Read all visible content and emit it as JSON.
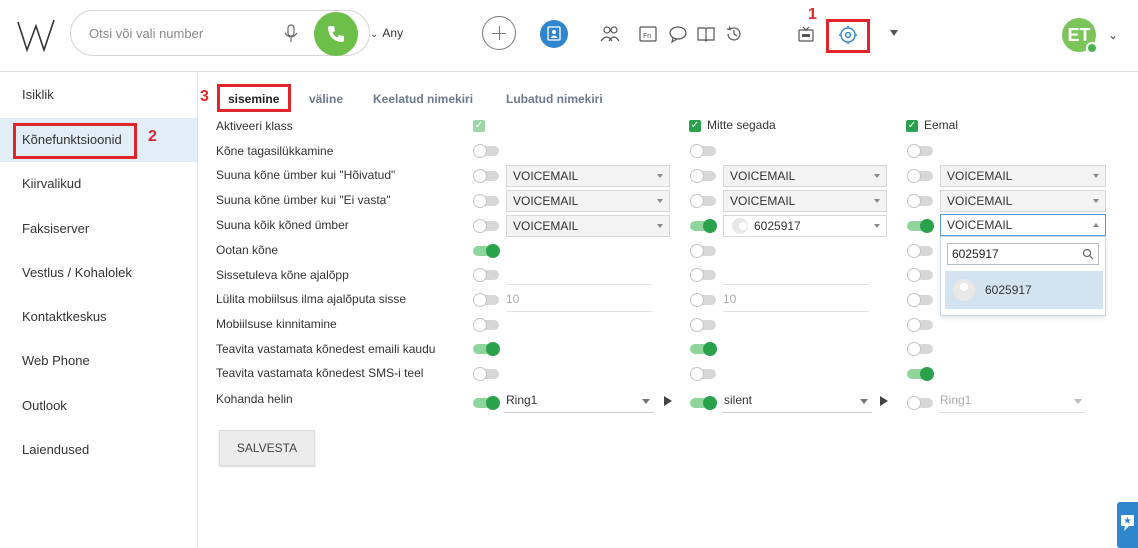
{
  "header": {
    "search_placeholder": "Otsi või vali number",
    "line_selector": "Any",
    "avatar_initials": "ET",
    "markers": {
      "settings": "1",
      "sidebar": "2",
      "tabs": "3"
    }
  },
  "sidebar": {
    "items": [
      {
        "label": "Isiklik"
      },
      {
        "label": "Kõnefunktsioonid",
        "active": true
      },
      {
        "label": "Kiirvalikud"
      },
      {
        "label": "Faksiserver"
      },
      {
        "label": "Vestlus / Kohalolek"
      },
      {
        "label": "Kontaktkeskus"
      },
      {
        "label": "Web Phone"
      },
      {
        "label": "Outlook"
      },
      {
        "label": "Laiendused"
      }
    ]
  },
  "tabs": [
    {
      "label": "sisemine",
      "active": true
    },
    {
      "label": "väline"
    },
    {
      "label": "Keelatud nimekiri"
    },
    {
      "label": "Lubatud nimekiri"
    }
  ],
  "columns": [
    "",
    "Mitte segada",
    "Eemal"
  ],
  "rows": [
    {
      "label": "Aktiveeri klass"
    },
    {
      "label": "Kõne tagasilükkamine"
    },
    {
      "label": "Suuna kõne ümber kui \"Hõivatud\"",
      "value": "VOICEMAIL"
    },
    {
      "label": "Suuna kõne ümber kui \"Ei vasta\"",
      "value": "VOICEMAIL"
    },
    {
      "label": "Suuna kõik kõned ümber",
      "value": "VOICEMAIL",
      "number": "6025917"
    },
    {
      "label": "Ootan kõne"
    },
    {
      "label": "Sissetuleva kõne ajalõpp"
    },
    {
      "label": "Lülita mobiilsus ilma ajalõputa sisse",
      "value": "10"
    },
    {
      "label": "Mobiilsuse kinnitamine"
    },
    {
      "label": "Teavita vastamata kõnedest emaili kaudu"
    },
    {
      "label": "Teavita vastamata kõnedest SMS-i teel"
    },
    {
      "label": "Kohanda helin"
    }
  ],
  "ringtones": [
    "Ring1",
    "silent",
    "Ring1"
  ],
  "dropdown": {
    "search_value": "6025917",
    "option": "6025917"
  },
  "save_label": "SALVESTA",
  "colors": {
    "accent_green": "#2aa24c",
    "highlight_red": "#e0262a",
    "brand_blue": "#2f86cf"
  }
}
